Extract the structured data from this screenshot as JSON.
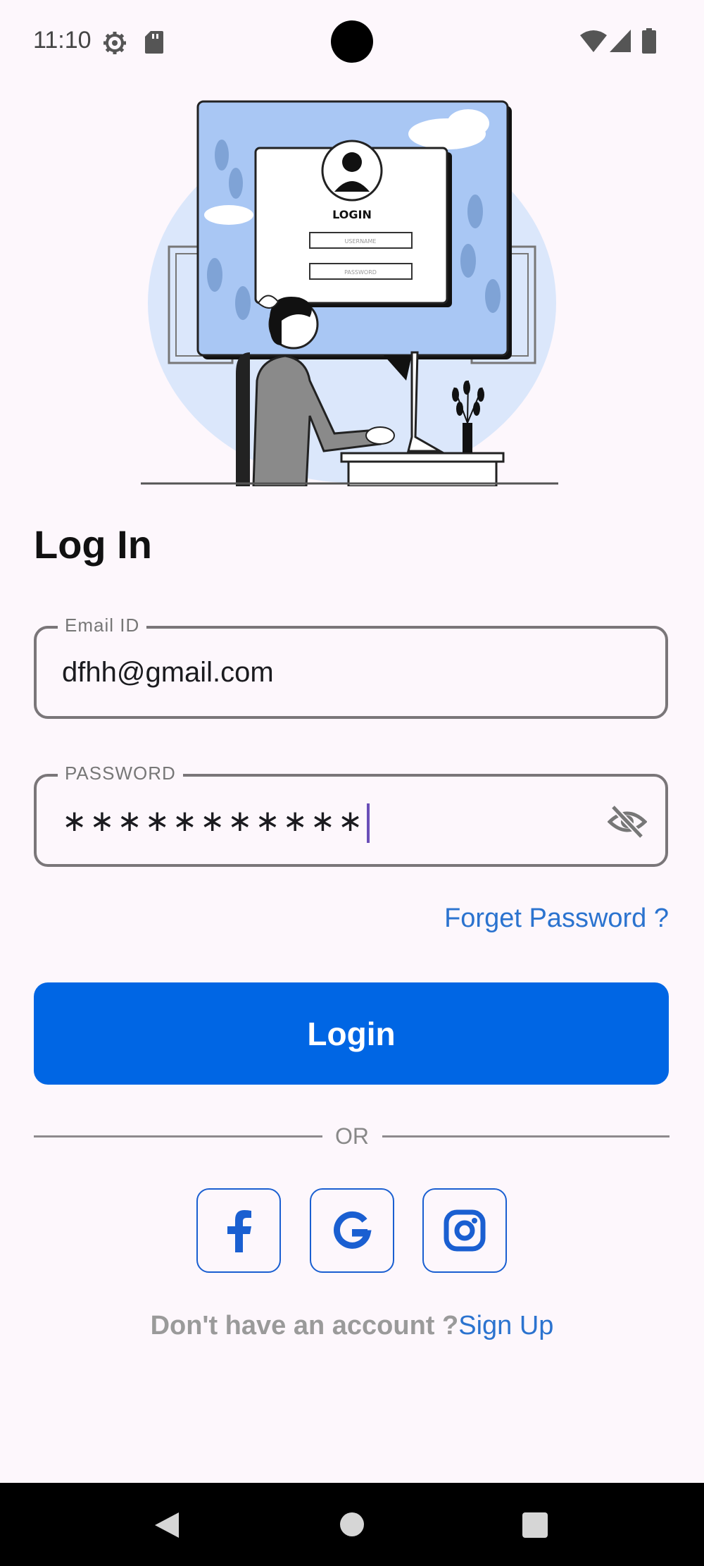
{
  "status_bar": {
    "time": "11:10",
    "icons": [
      "gear-icon",
      "sdcard-icon",
      "wifi-icon",
      "signal-icon",
      "battery-icon"
    ]
  },
  "illustration": {
    "card_title": "LOGIN",
    "username_placeholder": "USERNAME",
    "password_placeholder": "PASSWORD"
  },
  "page_title": "Log In",
  "email": {
    "label": "Email ID",
    "value": "dfhh@gmail.com"
  },
  "password": {
    "label": "PASSWORD",
    "masked_value": "∗∗∗∗∗∗∗∗∗∗∗",
    "visibility_icon": "eye-off-icon"
  },
  "forget_password": "Forget Password ?",
  "login_button": "Login",
  "divider_text": "OR",
  "social": [
    "facebook-icon",
    "google-icon",
    "instagram-icon"
  ],
  "signup": {
    "prompt": "Don't have an account ?",
    "link": "Sign Up"
  },
  "nav_bar": [
    "back-icon",
    "home-icon",
    "recents-icon"
  ],
  "colors": {
    "primary": "#0066e4",
    "link": "#2b73cf",
    "background": "#fdf7fc",
    "outline": "#7a7679"
  }
}
